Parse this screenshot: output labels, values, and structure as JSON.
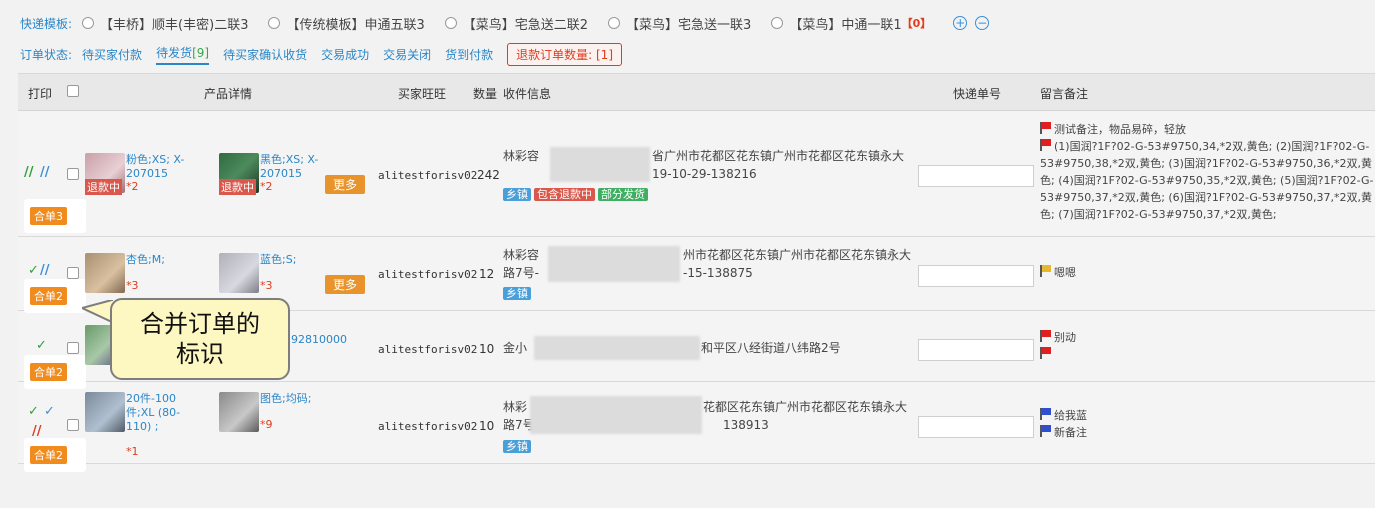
{
  "templates": {
    "label": "快递模板:",
    "options": [
      "【丰桥】顺丰(丰密)二联3",
      "【传统模板】申通五联3",
      "【菜鸟】宅急送二联2",
      "【菜鸟】宅急送一联3",
      "【菜鸟】中通一联1"
    ],
    "last_count": "【0】",
    "add_icon": "plus-circle-icon",
    "remove_icon": "minus-circle-icon"
  },
  "status": {
    "label": "订单状态:",
    "tabs": [
      {
        "label": "待买家付款",
        "count": ""
      },
      {
        "label": "待发货",
        "count": "[9]",
        "active": true
      },
      {
        "label": "待买家确认收货",
        "count": ""
      },
      {
        "label": "交易成功",
        "count": ""
      },
      {
        "label": "交易关闭",
        "count": ""
      },
      {
        "label": "货到付款",
        "count": ""
      }
    ],
    "refund_button": "退款订单数量: [1]"
  },
  "table": {
    "headers": {
      "print": "打印",
      "product": "产品详情",
      "buyer": "买家旺旺",
      "qty": "数量",
      "receiver": "收件信息",
      "tracking": "快递单号",
      "notes": "留言备注"
    },
    "rows": [
      {
        "marks": "//  //",
        "merge": "合单3",
        "p1_sku": "粉色;XS; X-207015",
        "p1_refund": "退款中",
        "p1_qty": "*2",
        "p2_sku": "黑色;XS; X-207015",
        "p2_refund": "退款中",
        "p2_qty": "*2",
        "more": "更多",
        "buyer": "alitestforisv02",
        "qty": "242",
        "addr1a": "林彩容",
        "addr1b": "省广州市花都区花东镇广州市花都区花东镇永大",
        "addr2": "19-10-29-138216",
        "tags": [
          "乡镇",
          "包含退款中",
          "部分发货"
        ],
        "notes": [
          {
            "flag": "red",
            "text": "测试备注，物品易碎，轻放"
          },
          {
            "flag": "red",
            "text": "(1)国润?1F?02-G-53#9750,34,*2双,黄色; (2)国润?1F?02-G-53#9750,38,*2双,黄色; (3)国润?1F?02-G-53#9750,36,*2双,黄色; (4)国润?1F?02-G-53#9750,35,*2双,黄色; (5)国润?1F?02-G-53#9750,37,*2双,黄色; (6)国润?1F?02-G-53#9750,37,*2双,黄色; (7)国润?1F?02-G-53#9750,37,*2双,黄色;"
          }
        ]
      },
      {
        "marks": "✓ //",
        "merge": "合单2",
        "p1_sku": "杏色;M;",
        "p1_qty": "*3",
        "p2_sku": "蓝色;S;",
        "p2_qty": "*3",
        "more": "更多",
        "buyer": "alitestforisv02",
        "qty": "12",
        "addr1a": "林彩容",
        "addr1b": "州市花都区花东镇广州市花都区花东镇永大",
        "addr2a": "路7号-",
        "addr2b": "-15-138875",
        "tags": [
          "乡镇"
        ],
        "notes": [
          {
            "flag": "yellow",
            "text": "嗯嗯"
          }
        ]
      },
      {
        "marks": "✓",
        "merge": "合单2",
        "p1_sku": "92810000",
        "buyer": "alitestforisv02",
        "qty": "10",
        "addr1a": "金小",
        "addr1b": "和平区八经街道八纬路2号",
        "notes": [
          {
            "flag": "red",
            "text": "别动"
          },
          {
            "flag": "red",
            "text": ""
          }
        ]
      },
      {
        "marks": "✓ ✓ //",
        "merge": "合单2",
        "p1_sku": "20件-100 件;XL (80- 110) ;",
        "p1_qty": "*1",
        "p2_sku": "图色;均码;",
        "p2_qty": "*9",
        "buyer": "alitestforisv02",
        "qty": "10",
        "addr1a": "林彩",
        "addr1b": "花都区花东镇广州市花都区花东镇永大",
        "addr2a": "路7号",
        "addr2b": "138913",
        "tags": [
          "乡镇"
        ],
        "notes": [
          {
            "flag": "blue",
            "text": "给我蓝"
          },
          {
            "flag": "blue",
            "text": "新备注"
          }
        ]
      }
    ]
  },
  "callout": {
    "line1": "合并订单的",
    "line2": "标识"
  }
}
